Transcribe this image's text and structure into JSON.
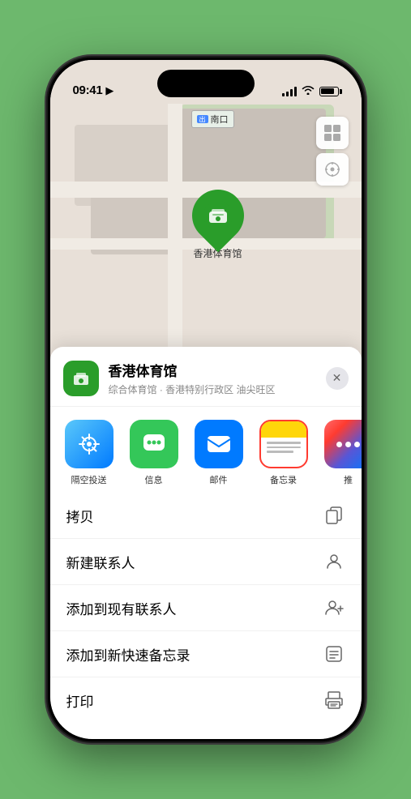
{
  "statusBar": {
    "time": "09:41",
    "locationArrow": "▶"
  },
  "map": {
    "label": "南口",
    "pinLabel": "香港体育馆"
  },
  "venueCard": {
    "name": "香港体育馆",
    "subtitle": "综合体育馆 · 香港特别行政区 油尖旺区",
    "closeLabel": "✕"
  },
  "shareItems": [
    {
      "id": "airdrop",
      "label": "隔空投送"
    },
    {
      "id": "messages",
      "label": "信息"
    },
    {
      "id": "mail",
      "label": "邮件"
    },
    {
      "id": "notes",
      "label": "备忘录"
    },
    {
      "id": "more",
      "label": "推"
    }
  ],
  "actionItems": [
    {
      "id": "copy",
      "label": "拷贝",
      "icon": "copy"
    },
    {
      "id": "new-contact",
      "label": "新建联系人",
      "icon": "person"
    },
    {
      "id": "add-existing",
      "label": "添加到现有联系人",
      "icon": "person-add"
    },
    {
      "id": "add-note",
      "label": "添加到新快速备忘录",
      "icon": "note"
    },
    {
      "id": "print",
      "label": "打印",
      "icon": "print"
    }
  ]
}
